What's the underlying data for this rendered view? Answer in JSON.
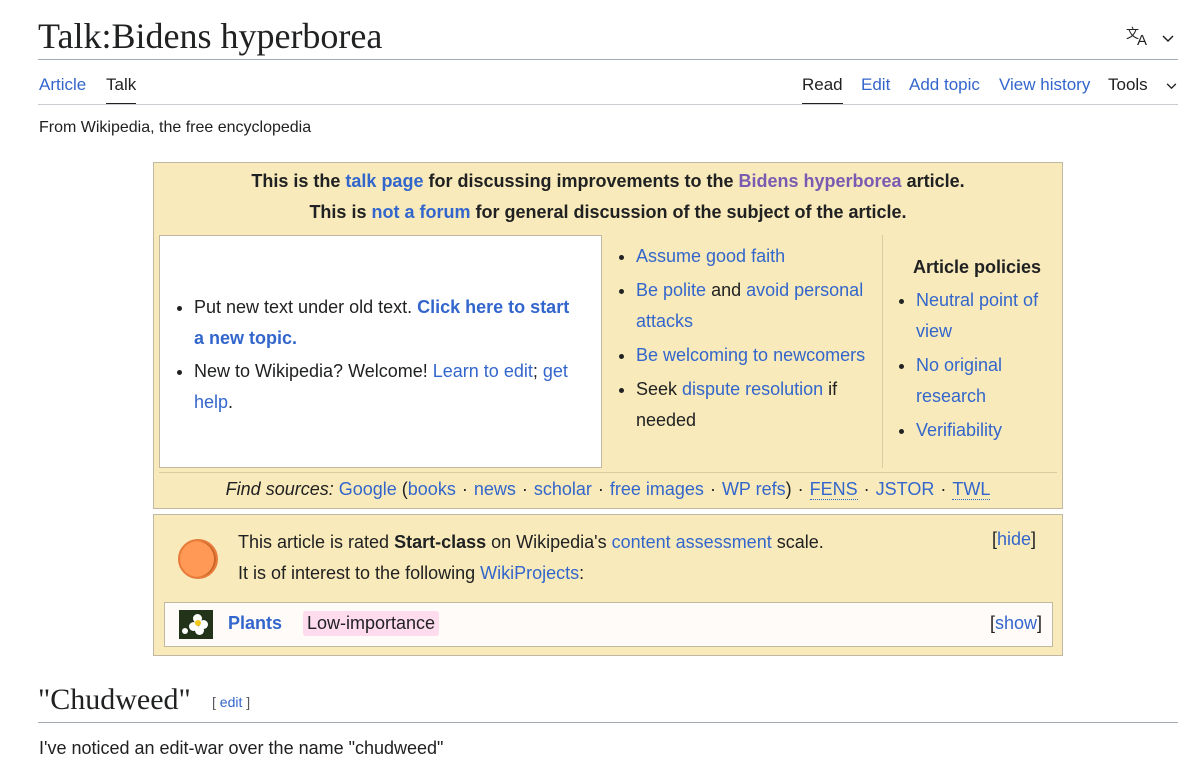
{
  "page": {
    "title": "Talk:Bidens hyperborea",
    "tagline": "From Wikipedia, the free encyclopedia"
  },
  "language_button": {
    "icon": "translate-icon"
  },
  "tabs": {
    "left": [
      {
        "label": "Article",
        "selected": false
      },
      {
        "label": "Talk",
        "selected": true
      }
    ],
    "right": [
      {
        "label": "Read",
        "selected": true
      },
      {
        "label": "Edit"
      },
      {
        "label": "Add topic"
      },
      {
        "label": "View history"
      },
      {
        "label": "Tools"
      }
    ]
  },
  "talk_header": {
    "line1": {
      "prefix": "This is the ",
      "talk_page_link": "talk page",
      "middle": " for discussing improvements to the ",
      "article_link": "Bidens hyperborea",
      "suffix": " article."
    },
    "line2": {
      "prefix": "This is ",
      "not_forum_link": "not a forum",
      "suffix": " for general discussion of the subject of the article."
    },
    "tips": {
      "item1_text": "Put new text under old text. ",
      "item1_link": "Click here to start a new topic.",
      "item2_text": "New to Wikipedia? Welcome! ",
      "item2_link1": "Learn to edit",
      "item2_sep": "; ",
      "item2_link2": "get help",
      "item2_end": "."
    },
    "guidelines": {
      "assume_good_faith": "Assume good faith",
      "be_polite": "Be polite",
      "and": " and ",
      "avoid_attacks": "avoid personal attacks",
      "be_welcoming": "Be welcoming to newcomers",
      "seek": "Seek ",
      "dispute_resolution": "dispute resolution",
      "if_needed": " if needed"
    },
    "policies": {
      "heading": "Article policies",
      "items": [
        "Neutral point of view",
        "No original research",
        "Verifiability"
      ]
    },
    "find_sources": {
      "label": "Find sources:",
      "google": "Google",
      "open_paren": " (",
      "books": "books",
      "news": "news",
      "scholar": "scholar",
      "free_images": "free images",
      "wp_refs": "WP refs",
      "close_paren": ")",
      "fens": "FENS",
      "jstor": "JSTOR",
      "twl": "TWL",
      "separator": "·"
    }
  },
  "wikiproject": {
    "rating_color": "#ff9955",
    "line1_prefix": "This article is rated ",
    "rating": "Start-class",
    "line1_middle": " on Wikipedia's ",
    "assessment_link": "content assessment",
    "line1_suffix": " scale.",
    "line2_prefix": "It is of interest to the following ",
    "wikiprojects_link": "WikiProjects",
    "line2_suffix": ":",
    "hide_label": "hide",
    "project": {
      "name": "Plants",
      "importance": "Low-importance",
      "importance_color": "#ffdbee",
      "show_label": "show"
    }
  },
  "section": {
    "heading": "\"Chudweed\"",
    "edit_label": "edit",
    "first_line": "I've noticed an edit-war over the name \"chudweed\""
  },
  "colors": {
    "link": "#3366cc",
    "visited_link": "#795cb2",
    "talk_box_bg": "#f8eaba"
  }
}
